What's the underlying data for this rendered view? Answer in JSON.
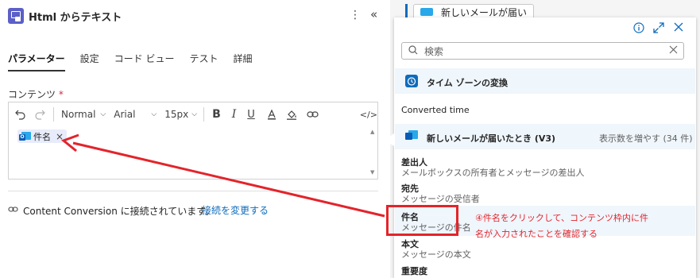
{
  "header": {
    "title": "Html からテキスト",
    "more_icon": "more-vertical-icon",
    "collapse_icon": "collapse-icon"
  },
  "tabs": [
    {
      "label": "パラメーター",
      "active": true
    },
    {
      "label": "設定"
    },
    {
      "label": "コード ビュー"
    },
    {
      "label": "テスト"
    },
    {
      "label": "詳細"
    }
  ],
  "content_field": {
    "label": "コンテンツ",
    "required_mark": "*"
  },
  "toolbar": {
    "format": "Normal",
    "font": "Arial",
    "size": "15px",
    "bold": "B",
    "italic": "I",
    "underline": "U",
    "code": "</>"
  },
  "chip": {
    "label": "件名",
    "remove": "×"
  },
  "connection": {
    "text": "Content Conversion に接続されています。",
    "change_link": "接続を変更する"
  },
  "top_card": {
    "label": "新しいメールが届い"
  },
  "flyout": {
    "search_placeholder": "検索",
    "timezone_action": "タイム ゾーンの変換",
    "converted_section": "Converted time",
    "trigger_section": "新しいメールが届いたとき (V3)",
    "show_more": "表示数を増やす (34 件)",
    "items": [
      {
        "title": "差出人",
        "sub": "メールボックスの所有者とメッセージの差出人"
      },
      {
        "title": "宛先",
        "sub": "メッセージの受信者"
      },
      {
        "title": "件名",
        "sub": "メッセージの件名"
      },
      {
        "title": "本文",
        "sub": "メッセージの本文"
      },
      {
        "title": "重要度",
        "sub": ""
      }
    ]
  },
  "annotation": {
    "line1": "④件名をクリックして、コンテンツ枠内に件",
    "line2": "名が入力されたことを確認する"
  },
  "colors": {
    "accent": "#0f6cbd",
    "annotation": "#e3242b",
    "chip_bg": "#e8ebfa"
  }
}
